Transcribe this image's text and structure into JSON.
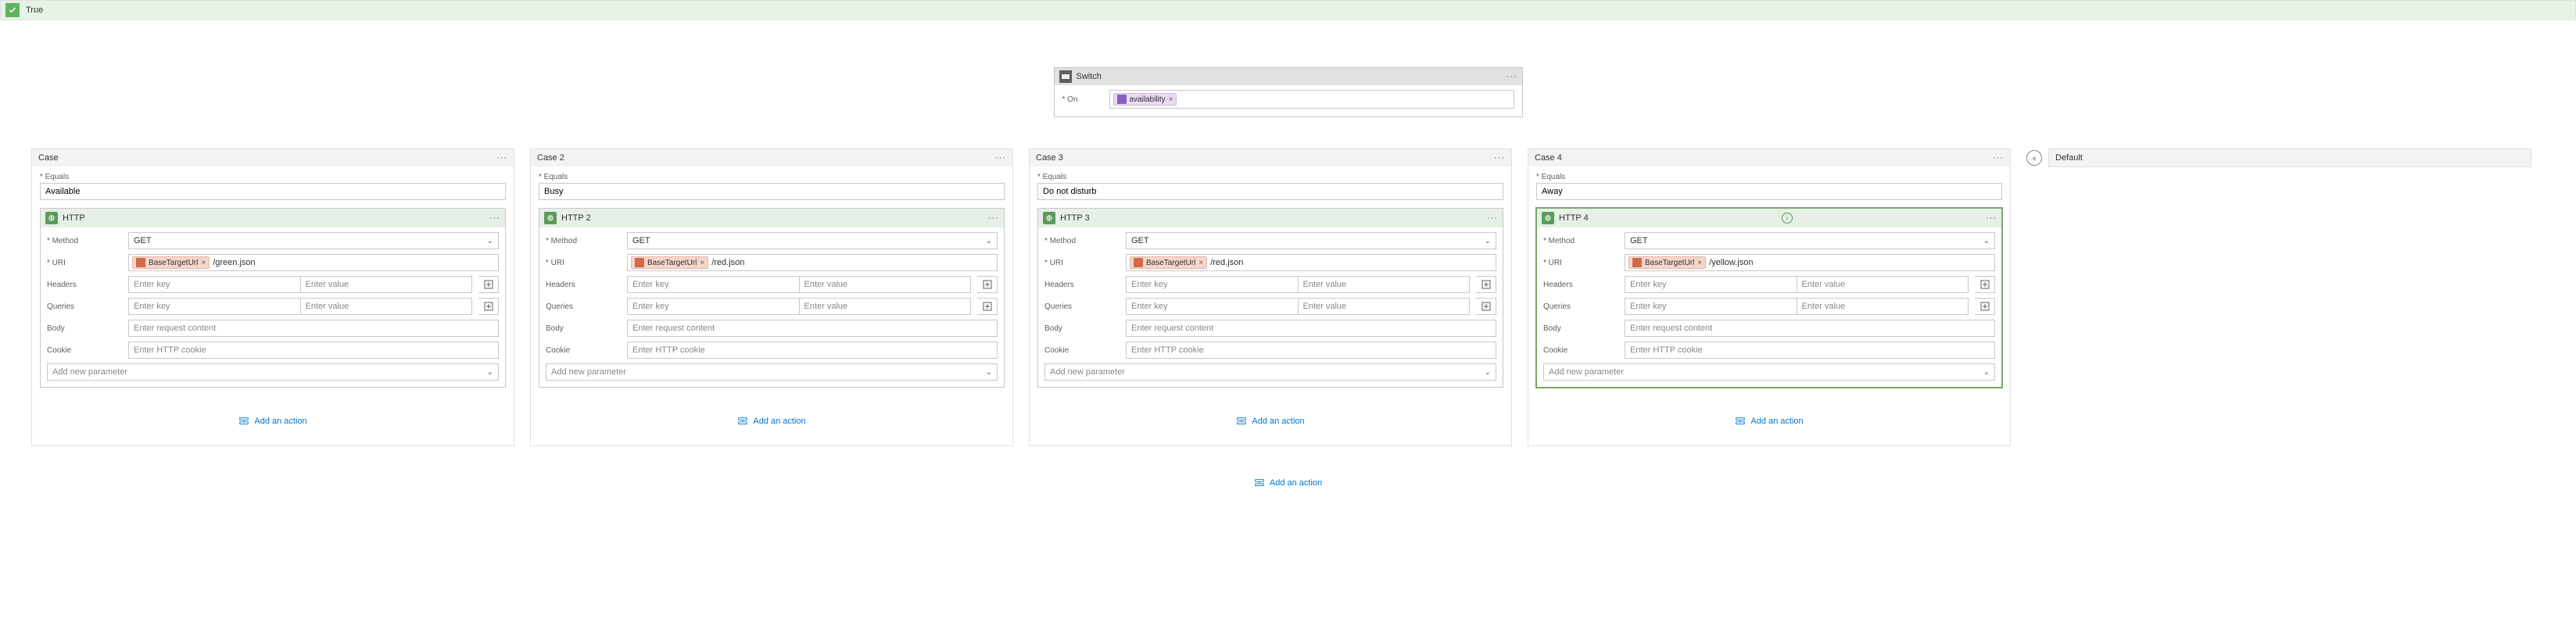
{
  "true_bar": {
    "label": "True"
  },
  "switch": {
    "title": "Switch",
    "on_label": "* On",
    "token": {
      "label": "availability"
    }
  },
  "labels": {
    "equals": "* Equals",
    "method": "* Method",
    "uri": "* URI",
    "headers": "Headers",
    "queries": "Queries",
    "body": "Body",
    "cookie": "Cookie",
    "enter_key": "Enter key",
    "enter_value": "Enter value",
    "enter_body": "Enter request content",
    "enter_cookie": "Enter HTTP cookie",
    "add_param": "Add new parameter",
    "add_action": "Add an action",
    "base_target": "BaseTargetUrl"
  },
  "cases": [
    {
      "title": "Case",
      "equals": "Available",
      "http_title": "HTTP",
      "method": "GET",
      "uri_suffix": "/green.json",
      "selected": false
    },
    {
      "title": "Case 2",
      "equals": "Busy",
      "http_title": "HTTP 2",
      "method": "GET",
      "uri_suffix": "/red.json",
      "selected": false
    },
    {
      "title": "Case 3",
      "equals": "Do not disturb",
      "http_title": "HTTP 3",
      "method": "GET",
      "uri_suffix": "/red.json",
      "selected": false
    },
    {
      "title": "Case 4",
      "equals": "Away",
      "http_title": "HTTP 4",
      "method": "GET",
      "uri_suffix": "/yellow.json",
      "selected": true
    }
  ],
  "default": {
    "title": "Default"
  }
}
